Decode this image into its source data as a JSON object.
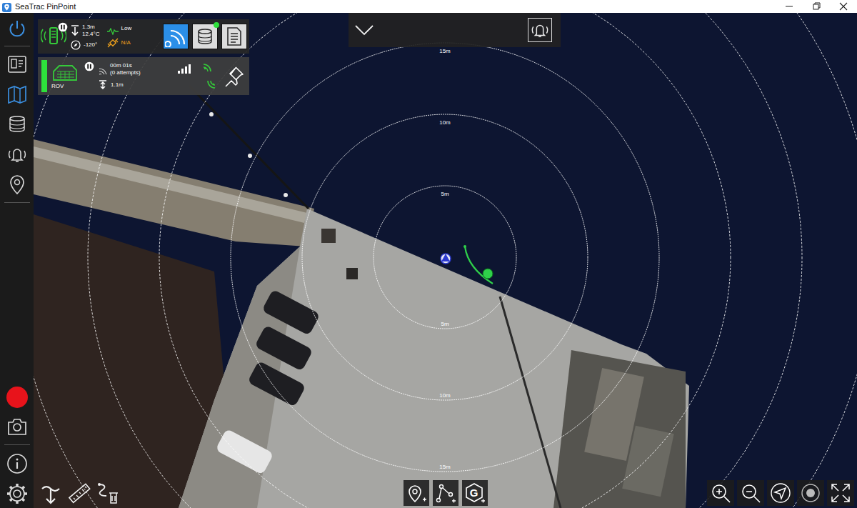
{
  "window": {
    "title": "SeaTrac PinPoint"
  },
  "sidebar": {
    "power_on": true,
    "items": [
      {
        "selected": false
      },
      {
        "selected": true
      },
      {
        "selected": false
      },
      {
        "selected": false
      },
      {
        "selected": false
      }
    ]
  },
  "beacon_panel": {
    "paused": true,
    "depth": "1.3m",
    "temperature": "12.4°C",
    "signal": "Low",
    "heading": "-120°",
    "gps": "N/A",
    "buttons": [
      {
        "selected": true,
        "indicator": false
      },
      {
        "selected": false,
        "indicator": true
      },
      {
        "selected": false,
        "indicator": false
      }
    ]
  },
  "rov_panel": {
    "label": "ROV",
    "online": true,
    "paused": true,
    "elapsed": "00m 01s",
    "attempts": "(0 attempts)",
    "depth": "1.1m",
    "signal_level": 1
  },
  "top_bar": {
    "expanded": false
  },
  "range_rings": {
    "top_labels": [
      "5m",
      "10m",
      "15m"
    ],
    "bottom_labels": [
      "5m",
      "10m",
      "15m"
    ]
  },
  "map_tools": {
    "geofence_label": "G"
  }
}
